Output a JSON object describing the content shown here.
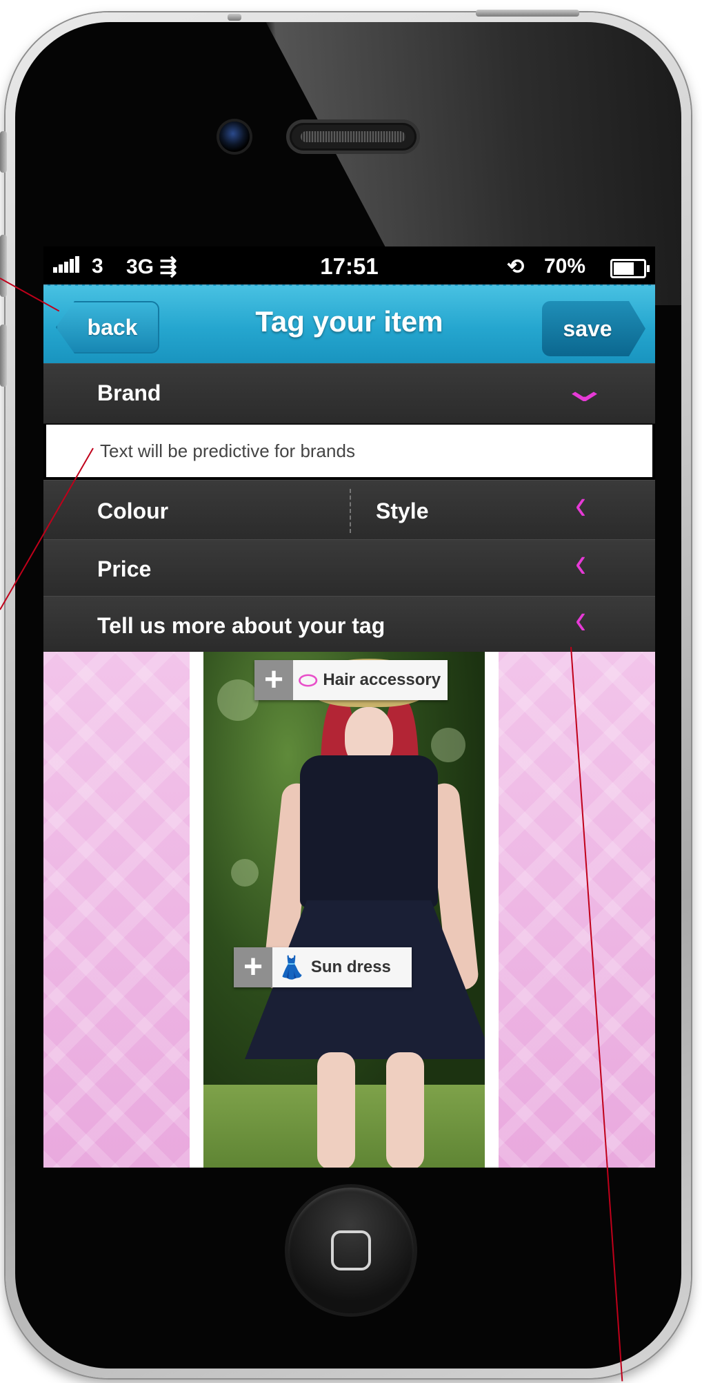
{
  "status_bar": {
    "carrier": "3",
    "network": "3G",
    "network_icon": "data-transfer-icon",
    "time": "17:51",
    "lock_icon": "rotation-lock-icon",
    "battery_percent": "70%",
    "battery_level": 0.7,
    "signal_bars": 5
  },
  "navbar": {
    "title": "Tag your item",
    "back_label": "back",
    "save_label": "save"
  },
  "form": {
    "brand_label": "Brand",
    "brand_placeholder": "Text will be predictive for brands",
    "colour_label": "Colour",
    "style_label": "Style",
    "price_label": "Price",
    "more_label": "Tell us more about your tag",
    "chevron_expanded": "⌄",
    "chevron_collapsed": "‹"
  },
  "tags": [
    {
      "label": "Hair accessory",
      "icon": "hair-accessory-icon",
      "plus": "+"
    },
    {
      "label": "Sun dress",
      "icon": "dress-icon",
      "plus": "+"
    }
  ],
  "colors": {
    "nav_blue": "#25a6cf",
    "accent_pink": "#e63ad6",
    "row_dark": "#333333",
    "annotation_red": "#c0001a"
  }
}
